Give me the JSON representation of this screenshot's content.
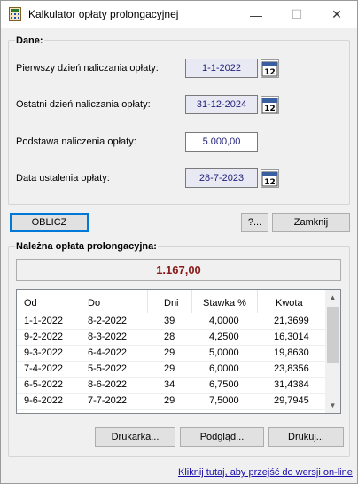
{
  "window": {
    "title": "Kalkulator opłaty prolongacyjnej",
    "controls": {
      "minimize": "—",
      "maximize": "☐",
      "close": "✕"
    }
  },
  "dane": {
    "title": "Dane:",
    "first_day_label": "Pierwszy dzień naliczania opłaty:",
    "first_day_value": "1-1-2022",
    "last_day_label": "Ostatni dzień naliczania opłaty:",
    "last_day_value": "31-12-2024",
    "base_label": "Podstawa naliczenia opłaty:",
    "base_value": "5.000,00",
    "date_label": "Data ustalenia opłaty:",
    "date_value": "28-7-2023"
  },
  "buttons": {
    "calculate": "OBLICZ",
    "help": "?...",
    "close": "Zamknij",
    "printer": "Drukarka...",
    "preview": "Podgląd...",
    "print": "Drukuj..."
  },
  "result": {
    "title": "Należna opłata prolongacyjna:",
    "value": "1.167,00"
  },
  "table": {
    "headers": [
      "Od",
      "Do",
      "Dni",
      "Stawka %",
      "Kwota"
    ],
    "rows": [
      [
        "1-1-2022",
        "8-2-2022",
        "39",
        "4,0000",
        "21,3699"
      ],
      [
        "9-2-2022",
        "8-3-2022",
        "28",
        "4,2500",
        "16,3014"
      ],
      [
        "9-3-2022",
        "6-4-2022",
        "29",
        "5,0000",
        "19,8630"
      ],
      [
        "7-4-2022",
        "5-5-2022",
        "29",
        "6,0000",
        "23,8356"
      ],
      [
        "6-5-2022",
        "8-6-2022",
        "34",
        "6,7500",
        "31,4384"
      ],
      [
        "9-6-2022",
        "7-7-2022",
        "29",
        "7,5000",
        "29,7945"
      ]
    ]
  },
  "footer": {
    "link": "Kliknij tutaj, aby przejść do wersji on-line"
  },
  "colors": {
    "accent": "#0078d7",
    "result_text": "#8b1a1a",
    "date_bg": "#e8e9f3",
    "value_text": "#1f1f7a"
  },
  "icons": {
    "app": "calculator-icon",
    "calendar": "calendar-icon"
  }
}
